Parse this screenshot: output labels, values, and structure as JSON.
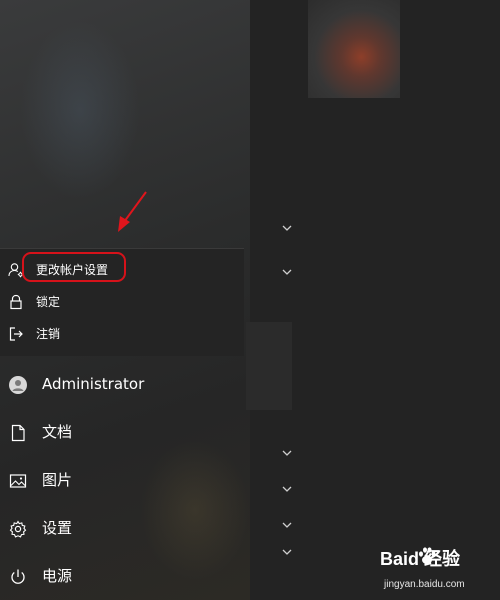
{
  "popup": {
    "items": [
      {
        "label": "更改帐户设置",
        "icon": "user-settings-icon"
      },
      {
        "label": "锁定",
        "icon": "lock-icon"
      },
      {
        "label": "注销",
        "icon": "sign-out-icon"
      }
    ]
  },
  "menu": {
    "items": [
      {
        "label": "Administrator",
        "icon": "avatar"
      },
      {
        "label": "文档",
        "icon": "document-icon"
      },
      {
        "label": "图片",
        "icon": "pictures-icon"
      },
      {
        "label": "设置",
        "icon": "gear-icon"
      },
      {
        "label": "电源",
        "icon": "power-icon"
      }
    ]
  },
  "watermark": {
    "brand": "Baid 经验",
    "url": "jingyan.baidu.com"
  },
  "colors": {
    "highlight": "#d6121a",
    "background": "#1e1e1e",
    "text": "#ffffff"
  }
}
